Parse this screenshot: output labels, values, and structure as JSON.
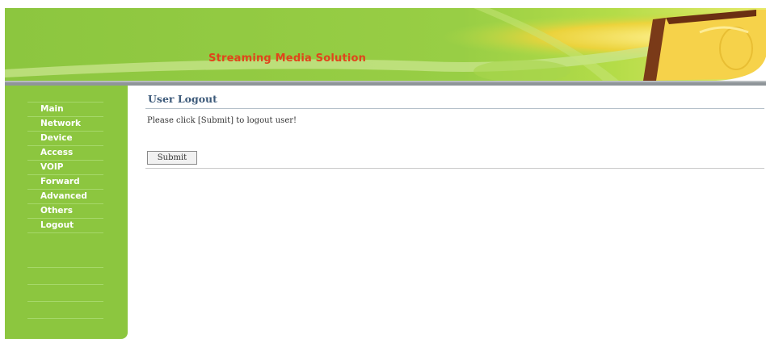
{
  "header": {
    "brand_title": "Streaming Media Solution"
  },
  "sidebar": {
    "items": [
      {
        "label": "Main"
      },
      {
        "label": "Network"
      },
      {
        "label": "Device"
      },
      {
        "label": "Access"
      },
      {
        "label": "VOIP"
      },
      {
        "label": "Forward"
      },
      {
        "label": "Advanced"
      },
      {
        "label": "Others"
      },
      {
        "label": "Logout"
      }
    ]
  },
  "main": {
    "title": "User Logout",
    "instruction": "Please click [Submit] to logout user!",
    "submit_label": "Submit"
  },
  "colors": {
    "header_green": "#8cc63f",
    "sidebar_green": "#8cc63f",
    "brand_text": "#e0451c",
    "title_text": "#3d5a7a"
  },
  "icons": [
    "monitor-graphic",
    "green-swoosh-graphic"
  ]
}
